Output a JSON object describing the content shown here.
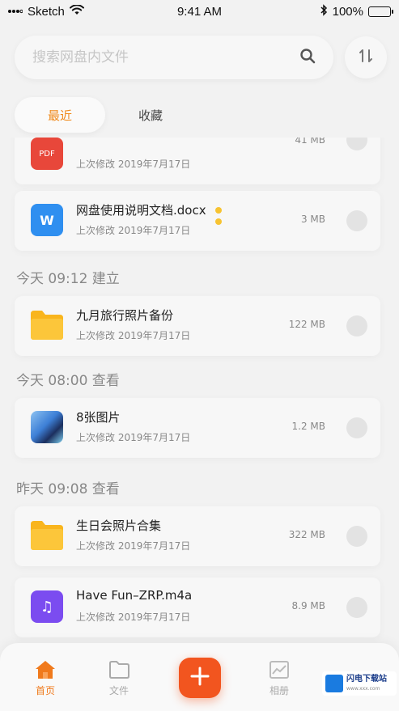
{
  "status_bar": {
    "carrier": "Sketch",
    "time": "9:41 AM",
    "battery": "100%"
  },
  "search": {
    "placeholder": "搜索网盘内文件"
  },
  "tabs": [
    {
      "label": "最近",
      "active": true
    },
    {
      "label": "收藏",
      "active": false
    }
  ],
  "files": [
    {
      "name": "",
      "icon_label": "PDF",
      "icon_color": "#e8473a",
      "modified": "上次修改 2019年7月17日",
      "size": "41 MB"
    },
    {
      "name": "网盘使用说明文档.docx",
      "icon_label": "W",
      "icon_color": "#2f8ff0",
      "modified": "上次修改 2019年7月17日",
      "size": "3 MB"
    },
    {
      "name": "九月旅行照片备份",
      "icon_label": "",
      "icon_color": "#f9b51d",
      "modified": "上次修改 2019年7月17日",
      "size": "122 MB"
    },
    {
      "name": "8张图片",
      "icon_label": "",
      "icon_color": "#3d7fd6",
      "modified": "上次修改 2019年7月17日",
      "size": "1.2 MB"
    },
    {
      "name": "生日会照片合集",
      "icon_label": "",
      "icon_color": "#f9b51d",
      "modified": "上次修改 2019年7月17日",
      "size": "322 MB"
    },
    {
      "name": "Have Fun–ZRP.m4a",
      "icon_label": "♫",
      "icon_color": "#7b4cf0",
      "modified": "上次修改 2019年7月17日",
      "size": "8.9 MB"
    }
  ],
  "sections": [
    {
      "label": "今天 09:12 建立"
    },
    {
      "label": "今天 08:00 查看"
    },
    {
      "label": "昨天 09:08 查看"
    }
  ],
  "bottom_nav": {
    "home": "首页",
    "files": "文件",
    "album": "相册"
  },
  "watermark": {
    "title": "闪电下载站",
    "url": "www.xxx.com"
  },
  "colors": {
    "accent": "#f08a1c",
    "add_button": "#f2551f"
  }
}
